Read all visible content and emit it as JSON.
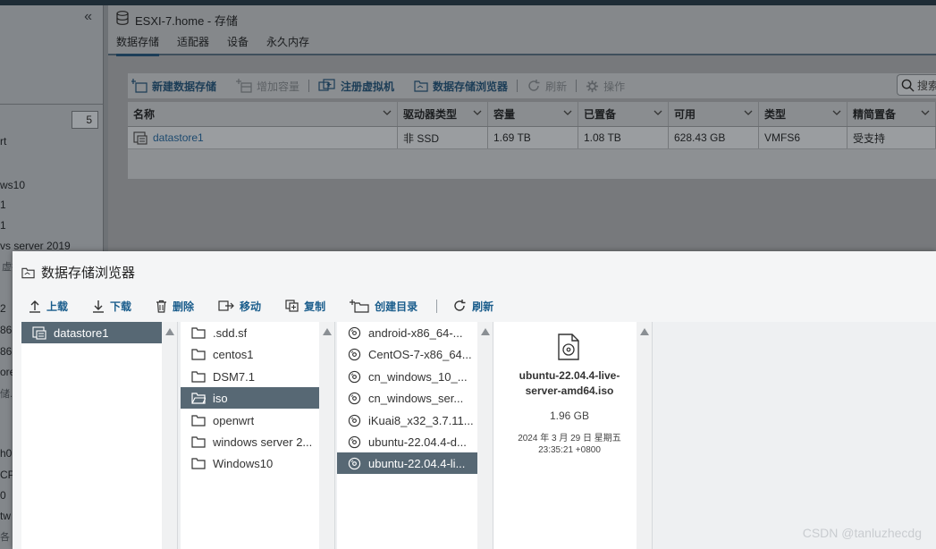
{
  "left_nav": {
    "count_badge": "5",
    "fragments": [
      "rt",
      "ws10",
      "1",
      "1",
      "vs server 2019",
      "虚拟机",
      "2",
      "86",
      "86",
      "ore",
      "储...",
      "h0",
      "CP,",
      "0",
      "tw",
      "各"
    ]
  },
  "header": {
    "title": "ESXI-7.home - 存储",
    "tabs": [
      "数据存储",
      "适配器",
      "设备",
      "永久内存"
    ]
  },
  "main_toolbar": {
    "new_datastore": "新建数据存储",
    "increase_capacity": "增加容量",
    "register_vm": "注册虚拟机",
    "datastore_browser": "数据存储浏览器",
    "refresh": "刷新",
    "actions": "操作",
    "search_placeholder": "搜索"
  },
  "table": {
    "columns": [
      "名称",
      "驱动器类型",
      "容量",
      "已置备",
      "可用",
      "类型",
      "精简置备"
    ],
    "rows": [
      {
        "name": "datastore1",
        "drive_type": "非 SSD",
        "capacity": "1.69 TB",
        "provisioned": "1.08 TB",
        "free": "628.43 GB",
        "type": "VMFS6",
        "thin": "受支持"
      }
    ]
  },
  "browser": {
    "title": "数据存储浏览器",
    "toolbar": {
      "upload": "上载",
      "download": "下载",
      "delete": "删除",
      "move": "移动",
      "copy": "复制",
      "mkdir": "创建目录",
      "refresh": "刷新"
    },
    "datastores": [
      "datastore1"
    ],
    "folders": [
      ".sdd.sf",
      "centos1",
      "DSM7.1",
      "iso",
      "openwrt",
      "windows server 2...",
      "Windows10"
    ],
    "selected_folder": "iso",
    "files": [
      "android-x86_64-...",
      "CentOS-7-x86_64...",
      "cn_windows_10_...",
      "cn_windows_ser...",
      "iKuai8_x32_3.7.11...",
      "ubuntu-22.04.4-d...",
      "ubuntu-22.04.4-li..."
    ],
    "selected_file_index": 6,
    "detail": {
      "name_line1": "ubuntu-22.04.4-live-",
      "name_line2": "server-amd64.iso",
      "size": "1.96 GB",
      "date_line1": "2024 年 3 月 29 日 星期五",
      "date_line2": "23:35:21 +0800"
    }
  },
  "watermark": "CSDN @tanluzhecdg",
  "colors": {
    "accent": "#1a5d8c",
    "selection": "#576874",
    "dim_overlay": "#6e7276"
  }
}
